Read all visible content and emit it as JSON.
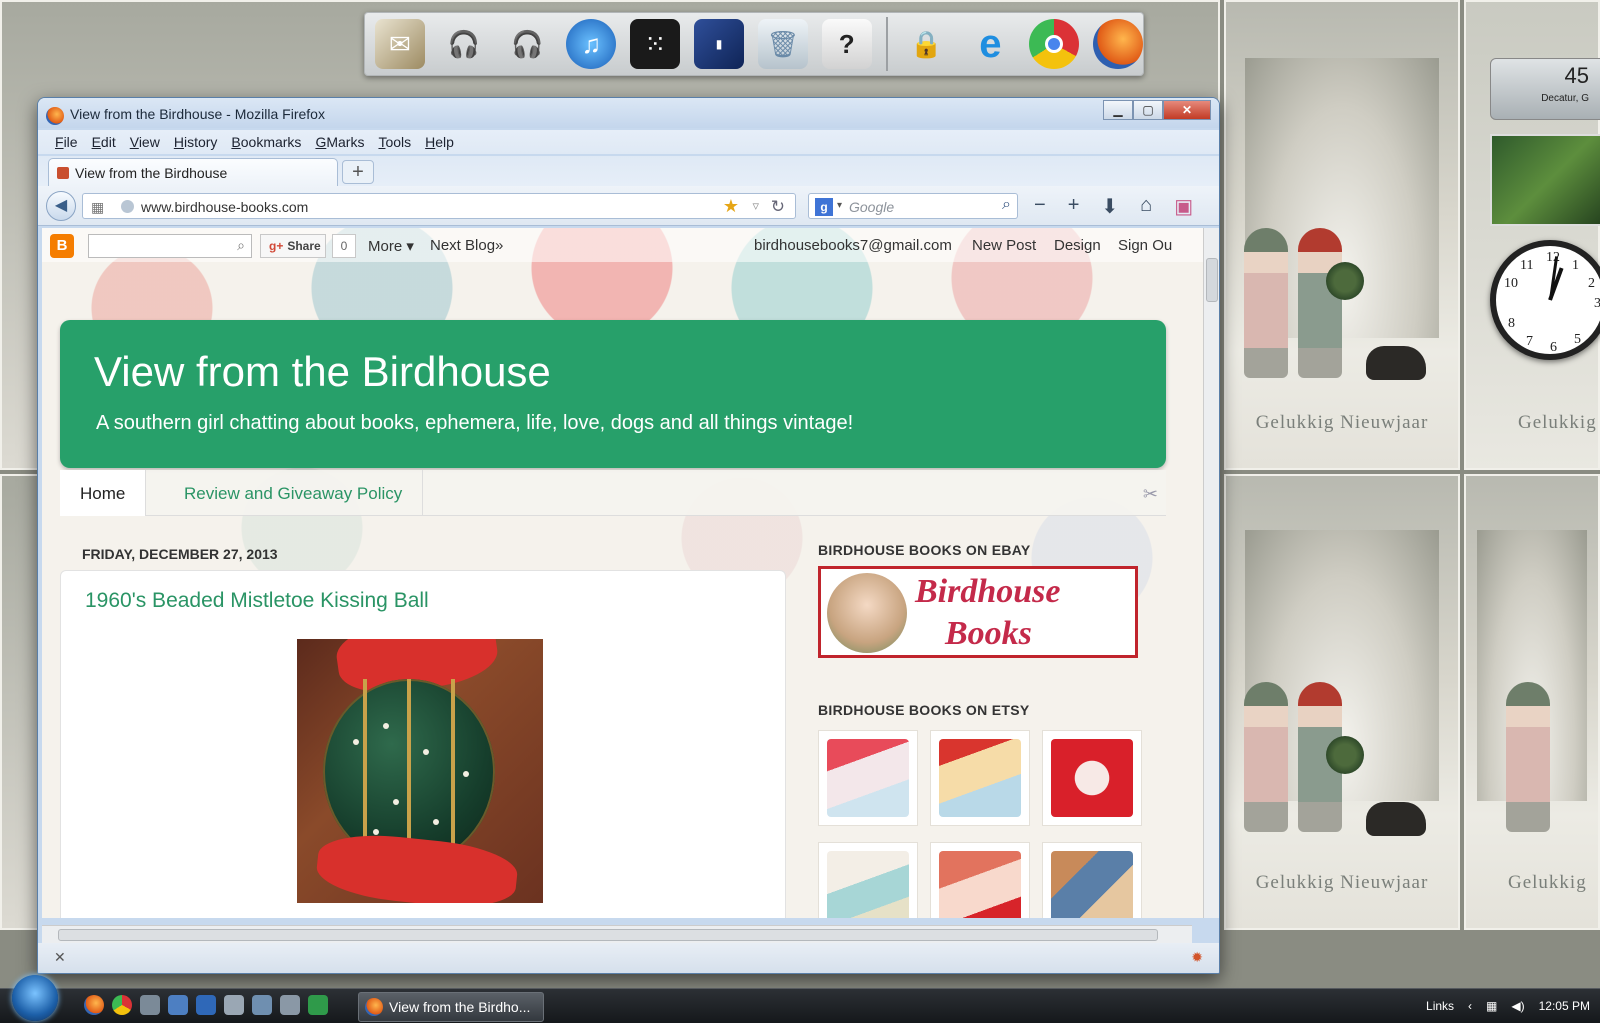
{
  "desktop": {
    "postcard_text": "Gelukkig  Nieuwjaar",
    "postcard_text_partial": "Gelukkig"
  },
  "dock": {
    "icons": [
      "mail-stack",
      "headphones",
      "headphones",
      "itunes",
      "blackberry",
      "my-book",
      "recycle-bin",
      "help",
      "lock",
      "internet-explorer",
      "chrome",
      "firefox"
    ]
  },
  "gadgets": {
    "weather_temp": "45",
    "weather_city": "Decatur, G",
    "clock_numbers": [
      "12",
      "1",
      "2",
      "3",
      "5",
      "6",
      "7",
      "8",
      "10",
      "11"
    ]
  },
  "browser": {
    "window_title": "View from the Birdhouse - Mozilla Firefox",
    "menu": [
      "File",
      "Edit",
      "View",
      "History",
      "Bookmarks",
      "GMarks",
      "Tools",
      "Help"
    ],
    "tab_title": "View from the Birdhouse",
    "new_tab": "+",
    "url": "www.birdhouse-books.com",
    "search_placeholder": "Google"
  },
  "blogger_bar": {
    "share_label": "Share",
    "share_count": "0",
    "more": "More ▾",
    "next_blog": "Next Blog»",
    "email": "birdhousebooks7@gmail.com",
    "new_post": "New Post",
    "design": "Design",
    "sign_out": "Sign Ou"
  },
  "blog": {
    "title": "View from the Birdhouse",
    "description": "A southern girl chatting about books, ephemera, life, love, dogs and all things vintage!",
    "tabs": [
      "Home",
      "Review and Giveaway Policy"
    ],
    "date_header": "FRIDAY, DECEMBER 27, 2013",
    "post_title": "1960's Beaded Mistletoe Kissing Ball"
  },
  "sidebar": {
    "ebay_title": "BIRDHOUSE BOOKS ON EBAY",
    "ebay_banner_line1": "Birdhouse",
    "ebay_banner_line2": "Books",
    "etsy_title": "BIRDHOUSE BOOKS ON ETSY"
  },
  "taskbar": {
    "task_label": "View from the Birdho...",
    "links_label": "Links",
    "time": "12:05 PM"
  },
  "colors": {
    "header_green": "#27a06a",
    "link_green": "#2a9465",
    "banner_red": "#c0242c"
  }
}
